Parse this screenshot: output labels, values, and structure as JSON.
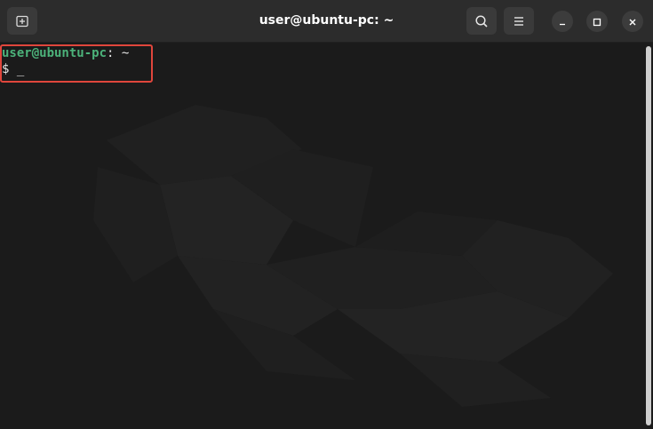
{
  "window": {
    "title": "user@ubuntu-pc: ~"
  },
  "toolbar": {
    "new_tab_icon": "new-tab-icon",
    "search_icon": "search-icon",
    "menu_icon": "hamburger-menu-icon"
  },
  "window_controls": {
    "minimize_icon": "minimize-icon",
    "maximize_icon": "maximize-icon",
    "close_icon": "close-icon"
  },
  "terminal": {
    "line1": {
      "userhost": "user@ubuntu-pc",
      "separator": ":",
      "path": " ~"
    },
    "line2": {
      "prompt": "$ ",
      "cursor": "_"
    }
  },
  "colors": {
    "titlebar": "#2c2c2c",
    "terminal_bg": "#1b1b1b",
    "prompt_green": "#4cb27a",
    "highlight_red": "#e0463c"
  }
}
